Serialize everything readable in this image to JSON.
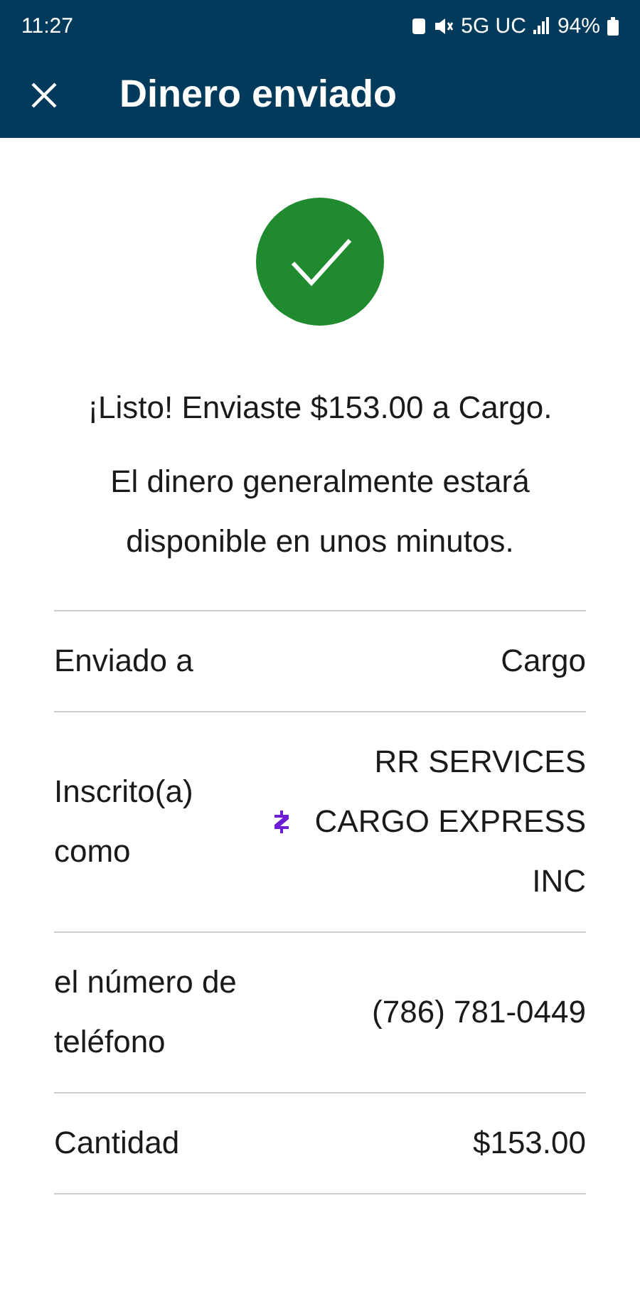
{
  "status_bar": {
    "time": "11:27",
    "network": "5G UC",
    "battery": "94%"
  },
  "header": {
    "title": "Dinero enviado"
  },
  "message": "¡Listo! Enviaste $153.00 a Cargo.",
  "note": "El dinero generalmente estará disponible en unos minutos.",
  "details": [
    {
      "kind": "plain",
      "label": "Enviado a",
      "value": "Cargo"
    },
    {
      "kind": "zelle",
      "label": "Inscrito(a) como",
      "value": "RR SERVICES CARGO EXPRESS INC"
    },
    {
      "kind": "plain",
      "label": "el número de teléfono",
      "value": "(786) 781-0449"
    },
    {
      "kind": "plain",
      "label": "Cantidad",
      "value": "$153.00"
    }
  ]
}
